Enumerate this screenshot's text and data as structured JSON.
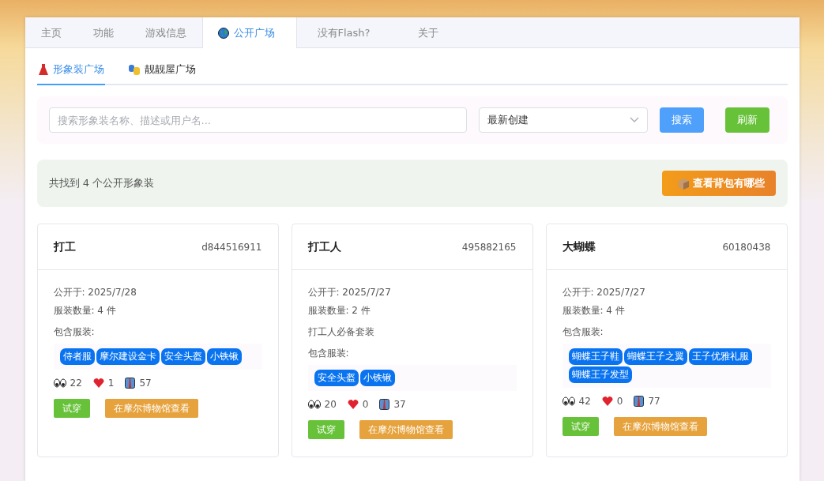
{
  "nav_tabs": [
    {
      "label": "主页",
      "selected": false
    },
    {
      "label": "功能",
      "selected": false
    },
    {
      "label": "游戏信息",
      "selected": false
    },
    {
      "label": "公开广场",
      "selected": true
    },
    {
      "label": "没有Flash?",
      "selected": false
    },
    {
      "label": "关于",
      "selected": false
    }
  ],
  "sub_tabs": [
    {
      "label": "形象装广场",
      "selected": true
    },
    {
      "label": "靓靓屋广场",
      "selected": false
    }
  ],
  "search": {
    "placeholder": "搜索形象装名称、描述或用户名...",
    "sort_value": "最新创建",
    "search_button": "搜索",
    "refresh_button": "刷新"
  },
  "summary": {
    "text": "共找到 4 个公开形象装",
    "backpack_button": "查看背包有哪些"
  },
  "cards": [
    {
      "title": "打工",
      "id": "d844516911",
      "published": "公开于: 2025/7/28",
      "count": "服装数量: 4 件",
      "items_label": "包含服装:",
      "items": [
        "侍者服",
        "摩尔建设金卡",
        "安全头盔",
        "小铁锹"
      ],
      "views": "22",
      "likes": "1",
      "wears": "57",
      "try_button": "试穿",
      "museum_button": "在摩尔博物馆查看"
    },
    {
      "title": "打工人",
      "id": "495882165",
      "published": "公开于: 2025/7/27",
      "count": "服装数量: 2 件",
      "description": "打工人必备套装",
      "items_label": "包含服装:",
      "items": [
        "安全头盔",
        "小铁锹"
      ],
      "views": "20",
      "likes": "0",
      "wears": "37",
      "try_button": "试穿",
      "museum_button": "在摩尔博物馆查看"
    },
    {
      "title": "大蝴蝶",
      "id": "60180438",
      "published": "公开于: 2025/7/27",
      "count": "服装数量: 4 件",
      "items_label": "包含服装:",
      "items": [
        "蝴蝶王子鞋",
        "蝴蝶王子之翼",
        "王子优雅礼服",
        "蝴蝶王子发型"
      ],
      "views": "42",
      "likes": "0",
      "wears": "77",
      "try_button": "试穿",
      "museum_button": "在摩尔博物馆查看"
    }
  ]
}
